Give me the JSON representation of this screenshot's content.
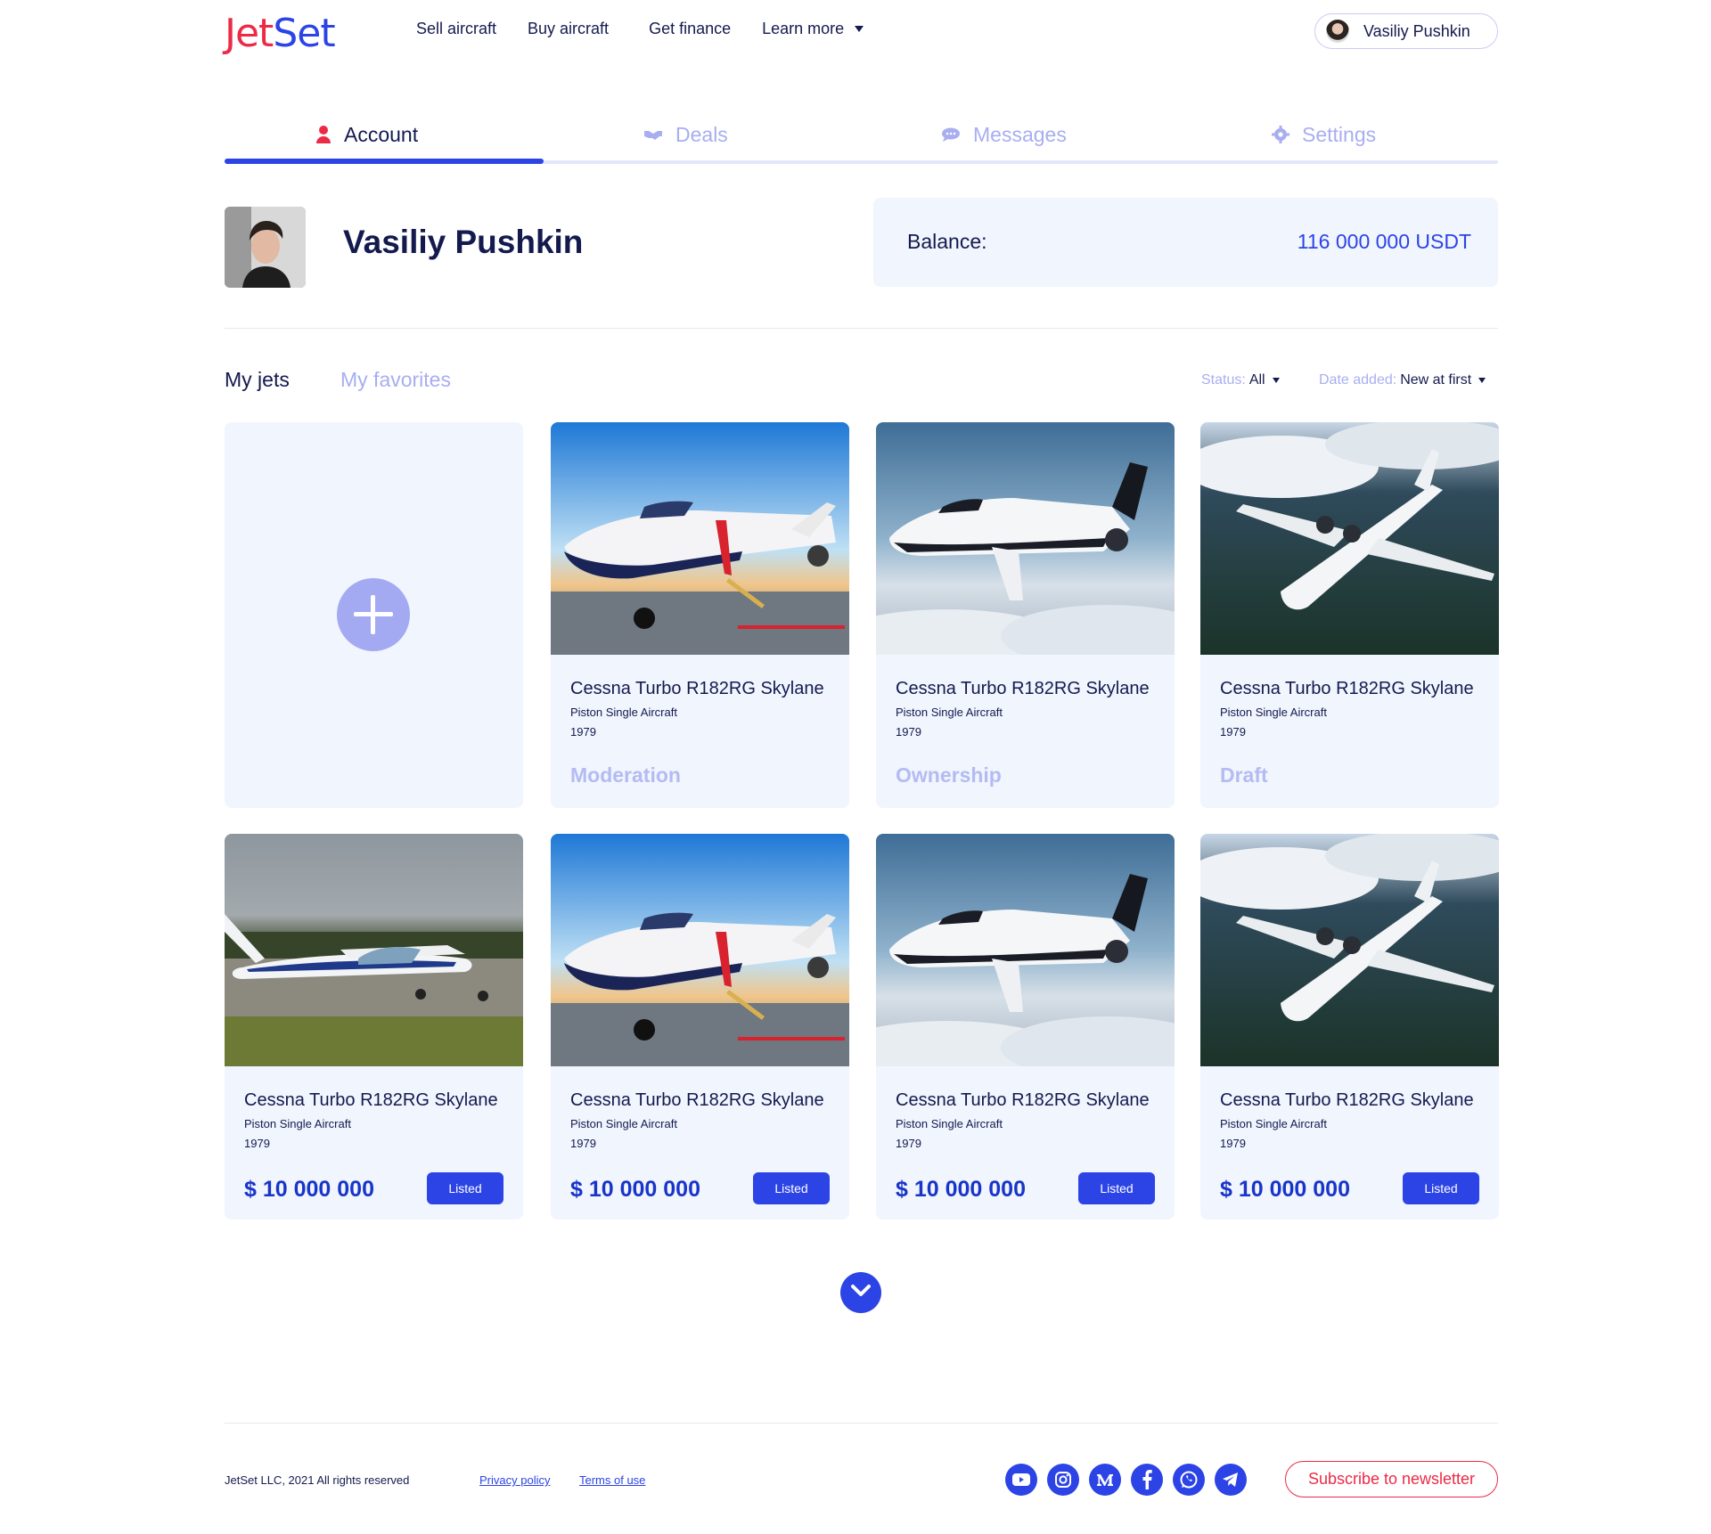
{
  "brand": {
    "logo_left": "Jet",
    "logo_right": "Set",
    "accent": "#2c44e6",
    "brand_red": "#ec2a46"
  },
  "nav": {
    "items": [
      "Sell aircraft",
      "Buy aircraft",
      "Get finance",
      "Learn more"
    ],
    "user_name": "Vasiliy Pushkin"
  },
  "tabs": [
    {
      "label": "Account",
      "icon": "user-icon"
    },
    {
      "label": "Deals",
      "icon": "handshake-icon"
    },
    {
      "label": "Messages",
      "icon": "chat-icon"
    },
    {
      "label": "Settings",
      "icon": "gear-icon"
    }
  ],
  "profile": {
    "name": "Vasiliy Pushkin",
    "balance_label": "Balance:",
    "balance_value": "116 000 000 USDT"
  },
  "jets_section": {
    "tab_my_jets": "My jets",
    "tab_favorites": "My favorites",
    "status_label": "Status:",
    "status_value": "All",
    "date_label": "Date added:",
    "date_value": "New at first"
  },
  "cards": [
    {
      "title": "Cessna Turbo R182RG Skylane",
      "subtitle": "Piston Single Aircraft",
      "year": "1979",
      "status": "Moderation",
      "image": "jet-ground-sunset"
    },
    {
      "title": "Cessna Turbo R182RG Skylane",
      "subtitle": "Piston Single Aircraft",
      "year": "1979",
      "status": "Ownership",
      "image": "jet-clouds"
    },
    {
      "title": "Cessna Turbo R182RG Skylane",
      "subtitle": "Piston Single Aircraft",
      "year": "1979",
      "status": "Draft",
      "image": "jet-mountains"
    },
    {
      "title": "Cessna Turbo R182RG Skylane",
      "subtitle": "Piston Single Aircraft",
      "year": "1979",
      "price": "$ 10 000 000",
      "button": "Listed",
      "image": "cessna-field"
    },
    {
      "title": "Cessna Turbo R182RG Skylane",
      "subtitle": "Piston Single Aircraft",
      "year": "1979",
      "price": "$ 10 000 000",
      "button": "Listed",
      "image": "jet-ground-sunset"
    },
    {
      "title": "Cessna Turbo R182RG Skylane",
      "subtitle": "Piston Single Aircraft",
      "year": "1979",
      "price": "$ 10 000 000",
      "button": "Listed",
      "image": "jet-clouds"
    },
    {
      "title": "Cessna Turbo R182RG Skylane",
      "subtitle": "Piston Single Aircraft",
      "year": "1979",
      "price": "$ 10 000 000",
      "button": "Listed",
      "image": "jet-mountains"
    }
  ],
  "footer": {
    "copyright": "JetSet LLC, 2021 All rights reserved",
    "privacy": "Privacy policy",
    "terms": "Terms of use",
    "socials": [
      "youtube-icon",
      "instagram-icon",
      "medium-icon",
      "facebook-icon",
      "whatsapp-icon",
      "telegram-icon"
    ],
    "newsletter": "Subscribe to newsletter"
  }
}
